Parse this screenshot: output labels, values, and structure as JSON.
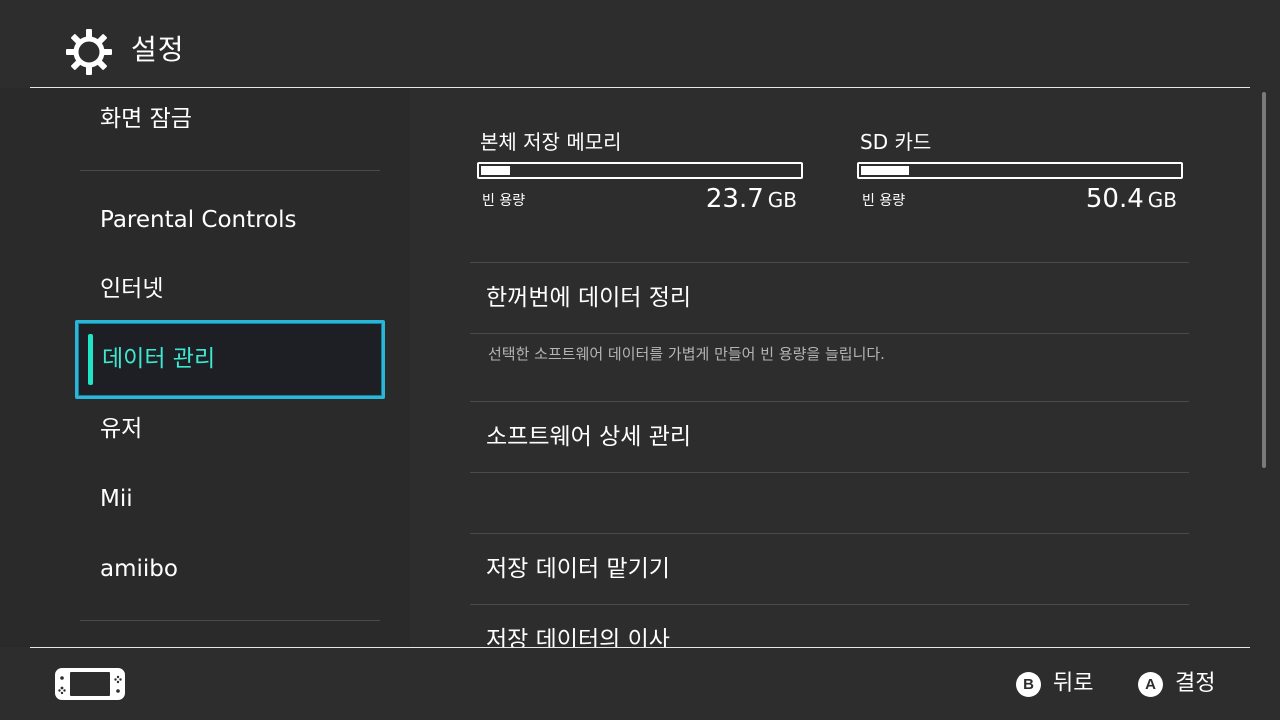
{
  "header": {
    "title": "설정",
    "icon": "gear-icon"
  },
  "sidebar": {
    "items": [
      {
        "label": "화면 잠금"
      },
      {
        "label": "Parental Controls"
      },
      {
        "label": "인터넷"
      },
      {
        "label": "데이터 관리",
        "selected": true
      },
      {
        "label": "유저"
      },
      {
        "label": "Mii"
      },
      {
        "label": "amiibo"
      }
    ]
  },
  "storage": {
    "system": {
      "title": "본체 저장 메모리",
      "free_label": "빈 용량",
      "free_value": "23.7",
      "unit": "GB",
      "used_fraction": 0.09
    },
    "sd": {
      "title": "SD 카드",
      "free_label": "빈 용량",
      "free_value": "50.4",
      "unit": "GB",
      "used_fraction": 0.15
    }
  },
  "main": {
    "items": [
      {
        "label": "한꺼번에 데이터 정리",
        "description": "선택한 소프트웨어 데이터를 가볍게 만들어 빈 용량을 늘립니다."
      },
      {
        "label": "소프트웨어 상세 관리"
      },
      {
        "label": "저장 데이터 맡기기"
      },
      {
        "label": "저장 데이터의 이사"
      }
    ]
  },
  "footer": {
    "back": {
      "key": "B",
      "label": "뒤로"
    },
    "confirm": {
      "key": "A",
      "label": "결정"
    }
  },
  "colors": {
    "accent": "#1ee4c8",
    "selection_border": "#29b6d9",
    "background": "#2d2d2d"
  }
}
